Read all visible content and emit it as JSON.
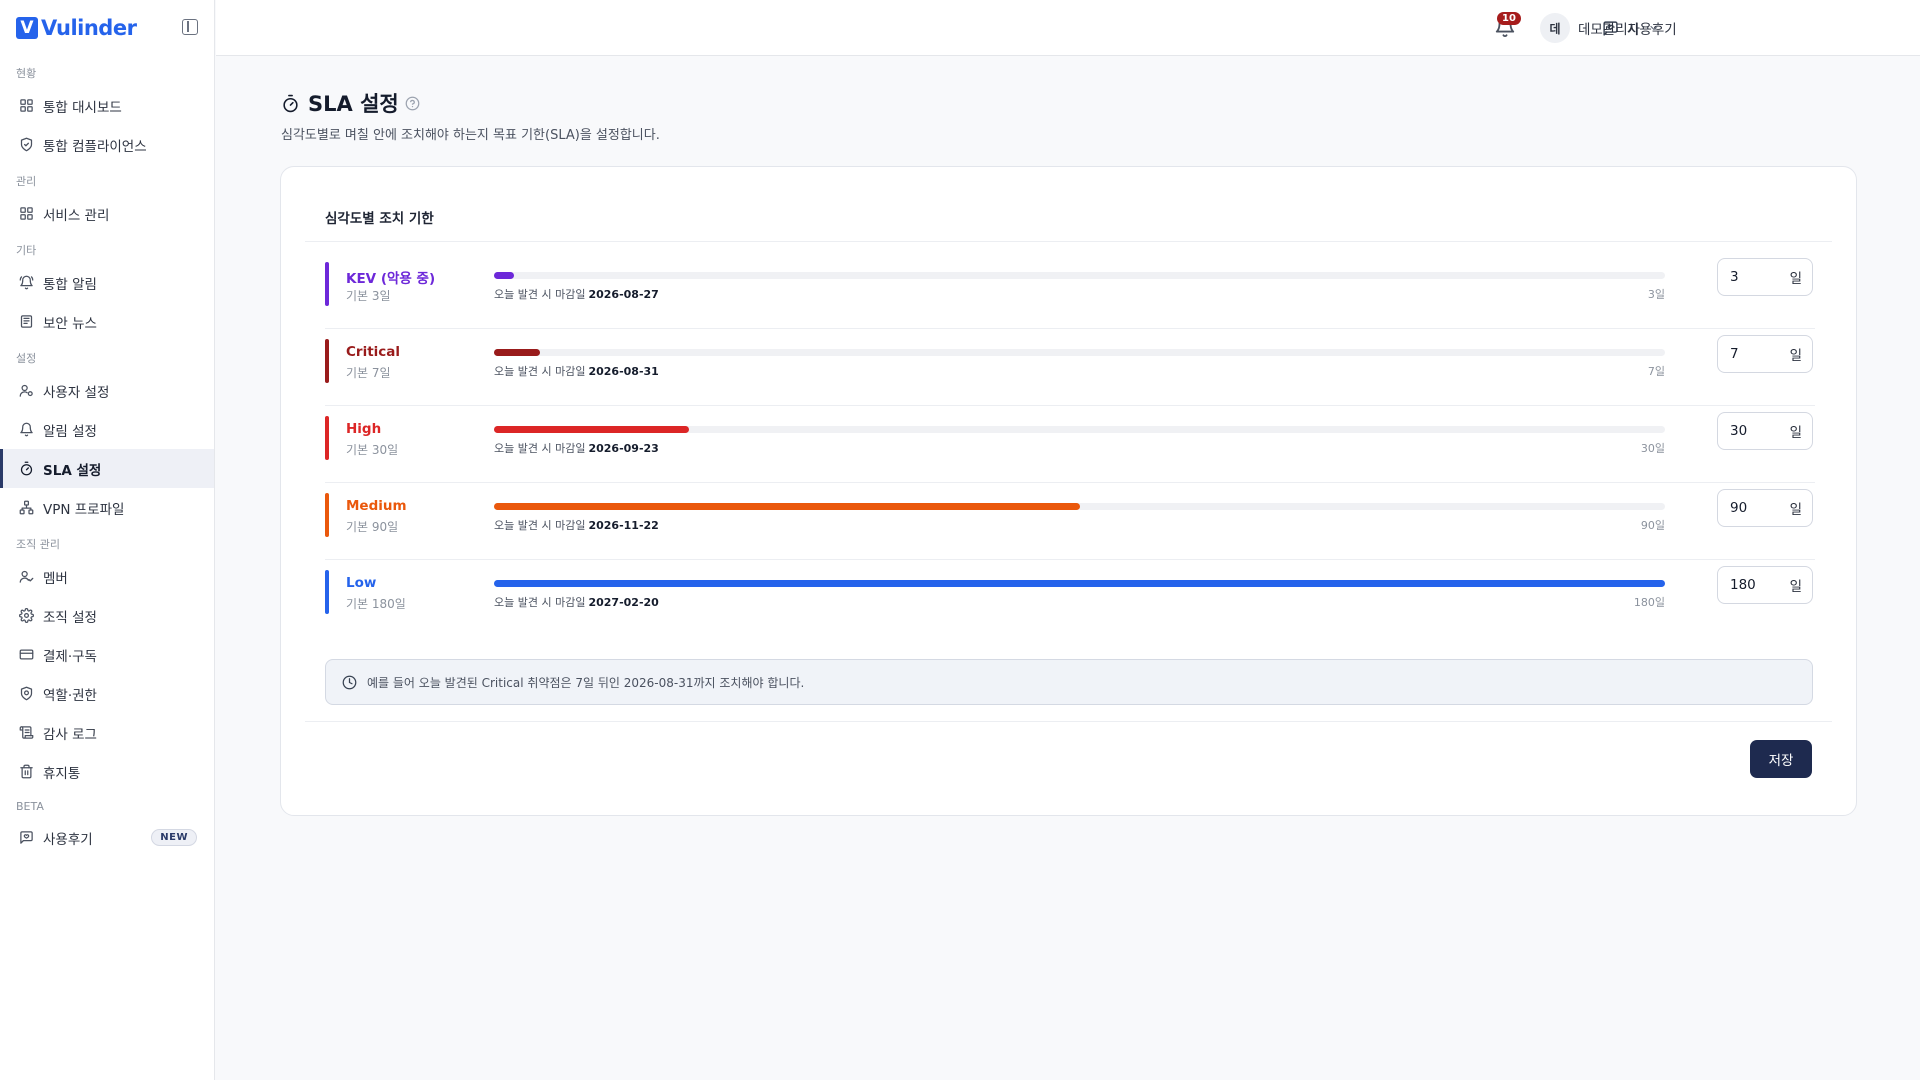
{
  "brand": {
    "logo_letter": "V",
    "name": "Vulinder"
  },
  "sidebar": {
    "sections": [
      {
        "label": "현황",
        "items": [
          {
            "label": "통합 대시보드",
            "icon": "dashboard-grid-icon"
          },
          {
            "label": "통합 컴플라이언스",
            "icon": "shield-check-icon"
          }
        ]
      },
      {
        "label": "관리",
        "items": [
          {
            "label": "서비스 관리",
            "icon": "dashboard-grid-icon"
          }
        ]
      },
      {
        "label": "기타",
        "items": [
          {
            "label": "통합 알림",
            "icon": "bell-ring-icon"
          },
          {
            "label": "보안 뉴스",
            "icon": "newspaper-icon"
          }
        ]
      },
      {
        "label": "설정",
        "items": [
          {
            "label": "사용자 설정",
            "icon": "user-settings-icon"
          },
          {
            "label": "알림 설정",
            "icon": "bell-icon"
          },
          {
            "label": "SLA 설정",
            "icon": "timer-icon",
            "active": true
          },
          {
            "label": "VPN 프로파일",
            "icon": "network-icon"
          }
        ]
      },
      {
        "label": "조직 관리",
        "items": [
          {
            "label": "멤버",
            "icon": "user-check-icon"
          },
          {
            "label": "조직 설정",
            "icon": "gear-icon"
          },
          {
            "label": "결제·구독",
            "icon": "credit-card-icon"
          },
          {
            "label": "역할·권한",
            "icon": "shield-gear-icon"
          },
          {
            "label": "감사 로그",
            "icon": "scroll-icon"
          },
          {
            "label": "휴지통",
            "icon": "trash-icon"
          }
        ]
      },
      {
        "label": "BETA",
        "items": [
          {
            "label": "사용후기",
            "icon": "feedback-icon",
            "badge": "NEW"
          }
        ]
      }
    ]
  },
  "header": {
    "feedback_label": "사용후기",
    "notification_count": "10",
    "user_initial": "데",
    "user_name": "데모관리자"
  },
  "page": {
    "title": "SLA 설정",
    "description": "심각도별로 며칠 안에 조치해야 하는지 목표 기한(SLA)을 설정합니다."
  },
  "card": {
    "title": "심각도별 조치 기한",
    "due_prefix": "오늘 발견 시 마감일",
    "unit": "일",
    "scale_max_days": 180,
    "rows": [
      {
        "name": "KEV (악용 중)",
        "default_label": "기본 3일",
        "days": "3",
        "days_value": 3,
        "due_date": "2026-08-27",
        "max_label": "3일",
        "color": "#6d28d9"
      },
      {
        "name": "Critical",
        "default_label": "기본 7일",
        "days": "7",
        "days_value": 7,
        "due_date": "2026-08-31",
        "max_label": "7일",
        "color": "#991b1b"
      },
      {
        "name": "High",
        "default_label": "기본 30일",
        "days": "30",
        "days_value": 30,
        "due_date": "2026-09-23",
        "max_label": "30일",
        "color": "#dc2626"
      },
      {
        "name": "Medium",
        "default_label": "기본 90일",
        "days": "90",
        "days_value": 90,
        "due_date": "2026-11-22",
        "max_label": "90일",
        "color": "#ea580c"
      },
      {
        "name": "Low",
        "default_label": "기본 180일",
        "days": "180",
        "days_value": 180,
        "due_date": "2027-02-20",
        "max_label": "180일",
        "color": "#2563eb"
      }
    ],
    "example_text": "예를 들어 오늘 발견된 Critical 취약점은 7일 뒤인 2026-08-31까지 조치해야 합니다.",
    "save_label": "저장"
  }
}
